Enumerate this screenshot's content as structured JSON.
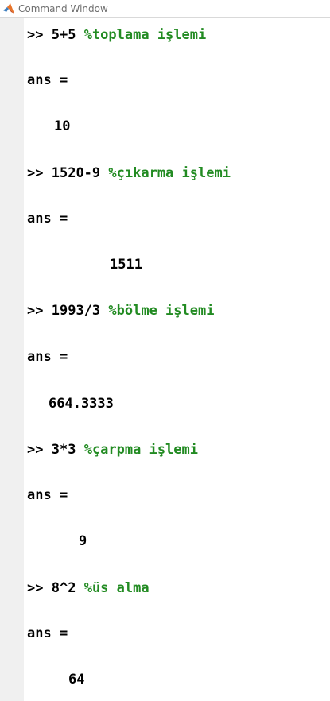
{
  "window": {
    "title": "Command Window",
    "icon": "matlab-logo-icon",
    "accent_colors": {
      "comment": "#228b22",
      "text": "#000000",
      "gutter": "#f0f0f0"
    }
  },
  "console": {
    "entries": [
      {
        "prompt": ">>",
        "command": "5+5",
        "comment": "%toplama işlemi",
        "result_label": "ans =",
        "result_value": "10"
      },
      {
        "prompt": ">>",
        "command": "1520-9",
        "comment": "%çıkarma işlemi",
        "result_label": "ans =",
        "result_value": "1511"
      },
      {
        "prompt": ">>",
        "command": "1993/3",
        "comment": "%bölme işlemi",
        "result_label": "ans =",
        "result_value": "664.3333"
      },
      {
        "prompt": ">>",
        "command": "3*3",
        "comment": "%çarpma işlemi",
        "result_label": "ans =",
        "result_value": "9"
      },
      {
        "prompt": ">>",
        "command": "8^2",
        "comment": "%üs alma",
        "result_label": "ans =",
        "result_value": "64"
      }
    ]
  }
}
